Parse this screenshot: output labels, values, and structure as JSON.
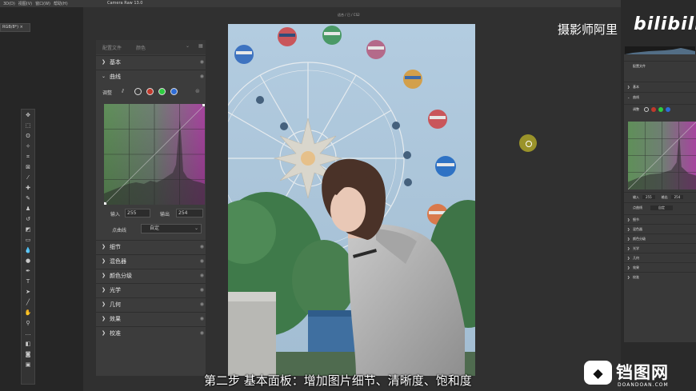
{
  "ps_menu": [
    "3D(D)",
    "视图(V)",
    "窗口(W)",
    "帮助(H)"
  ],
  "ps_doc_tab": "RGB/8*) ×",
  "camera_raw": {
    "window_title": "Camera Raw 13.0",
    "image_info": "适合 / 已 / CS2"
  },
  "panel": {
    "profile_label": "配置文件",
    "profile_value": "颜色",
    "sections_top": [
      {
        "name": "基本",
        "expanded": false
      },
      {
        "name": "曲线",
        "expanded": true
      }
    ],
    "curve": {
      "adjust_label": "调整",
      "channels": [
        {
          "name": "white-channel",
          "color": "#ffffff"
        },
        {
          "name": "red-channel",
          "color": "#c0392b"
        },
        {
          "name": "green-channel",
          "color": "#2ecc40"
        },
        {
          "name": "blue-channel",
          "color": "#2e6cd6"
        }
      ],
      "input_label": "输入",
      "input_value": "255",
      "output_label": "输出",
      "output_value": "254",
      "point_curve_label": "点曲线",
      "point_curve_value": "自定"
    },
    "sections_bottom": [
      "细节",
      "混色器",
      "颜色分级",
      "光学",
      "几何",
      "效果",
      "校准"
    ]
  },
  "ref_panel": {
    "header_left": "编辑",
    "profile_label": "配置文件",
    "profile_value": "颜色",
    "auto": "自动",
    "sections_top": [
      "基本",
      "曲线"
    ],
    "adjust_label": "调整",
    "input_label": "输入",
    "input_value": "255",
    "output_label": "输出",
    "output_value": "254",
    "point_curve_label": "点曲线",
    "point_curve_value": "自定",
    "sections_bottom": [
      "细节",
      "混色器",
      "颜色分级",
      "光学",
      "几何",
      "效果",
      "校准"
    ]
  },
  "overlay": {
    "channel_name": "摄影师阿里",
    "bilibili": "bilibili",
    "subtitle": "第二步  基本面板：增加图片细节、清晰度、饱和度",
    "watermark": "铛图网",
    "watermark_sub": "DOANDOAN.COM"
  },
  "colors": {
    "panel_bg": "#3c3c3c",
    "dialog_bg": "#303030",
    "curve_grid_green": "#5a8a55",
    "curve_grid_magenta": "#a0409a",
    "yellow_cursor": "#bdb428"
  }
}
